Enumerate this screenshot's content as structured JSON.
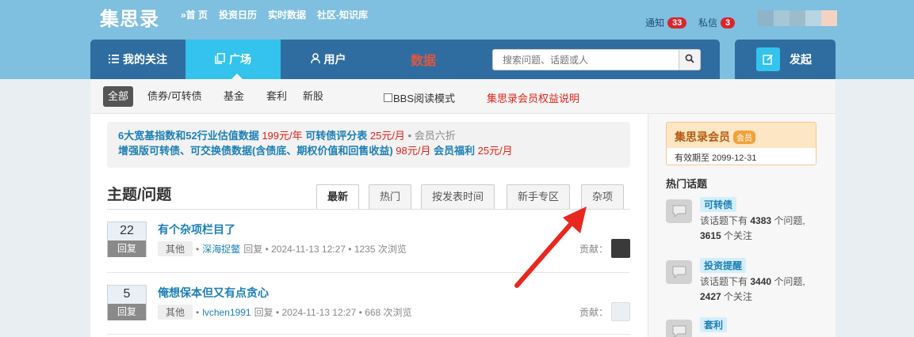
{
  "header": {
    "logo": "集思录",
    "nav": [
      "»首 页",
      "投资日历",
      "实时数据",
      "社区-知识库"
    ],
    "notifications_label": "通知",
    "notifications_count": "33",
    "messages_label": "私信",
    "messages_count": "3"
  },
  "main_nav": {
    "tabs": [
      {
        "label": "我的关注",
        "icon": "list-icon"
      },
      {
        "label": "广场",
        "icon": "copy-icon",
        "active": true
      },
      {
        "label": "用户",
        "icon": "user-icon"
      },
      {
        "label": "数据"
      }
    ],
    "search_placeholder": "搜索问题、话题或人",
    "post_label": "发起"
  },
  "filters": {
    "items": [
      "全部",
      "债券/可转债",
      "基金",
      "套利",
      "新股"
    ],
    "active": "全部",
    "bbs_mode": "BBS阅读模式",
    "member_rights": "集思录会员权益说明"
  },
  "promo": {
    "line1": [
      {
        "text": "6大宽基指数和52行业估值数据",
        "style": "blue"
      },
      {
        "text": " 199元/年",
        "style": "red"
      },
      {
        "text": "   可转债评分表",
        "style": "blue"
      },
      {
        "text": " 25元/月",
        "style": "red"
      },
      {
        "text": " • 会员六折",
        "style": "gray"
      }
    ],
    "line2": [
      {
        "text": "增强版可转债、可交换债数据(含债底、期权价值和回售收益)",
        "style": "blue"
      },
      {
        "text": " 98元/月",
        "style": "red"
      },
      {
        "text": "   会员福利",
        "style": "blue"
      },
      {
        "text": " 25元/月",
        "style": "red"
      }
    ]
  },
  "section": {
    "title": "主题/问题",
    "tabs": [
      "最新",
      "热门",
      "按发表时间",
      "新手专区",
      "杂项"
    ],
    "active_tab": "最新"
  },
  "questions": [
    {
      "count": "22",
      "count_label": "回复",
      "title": "有个杂项栏目了",
      "category": "其他",
      "user": "深海捉鳖",
      "meta": "回复 • 2024-11-13 12:27 • 1235 次浏览",
      "contrib_label": "贡献："
    },
    {
      "count": "5",
      "count_label": "回复",
      "title": "俺想保本但又有点贪心",
      "category": "其他",
      "user": "lvchen1991",
      "meta": "回复 • 2024-11-13 12:27 • 668 次浏览",
      "contrib_label": "贡献："
    }
  ],
  "sidebar": {
    "member_title": "集思录会员",
    "member_tag": "会员",
    "member_expiry": "有效期至 2099-12-31",
    "hot_topics_title": "热门话题",
    "topics": [
      {
        "name": "可转债",
        "line1_pre": "该话题下有 ",
        "questions": "4383",
        "line1_post": " 个问题,",
        "follows": "3615",
        "line2_post": " 个关注"
      },
      {
        "name": "投资提醒",
        "line1_pre": "该话题下有 ",
        "questions": "3440",
        "line1_post": " 个问题,",
        "follows": "2427",
        "line2_post": " 个关注"
      },
      {
        "name": "套利",
        "line1_pre": "该话题下有 ",
        "questions": "",
        "line1_post": "",
        "follows": "",
        "line2_post": ""
      }
    ]
  },
  "colors": {
    "header_bg": "#7fbfe0",
    "nav_bg": "#2f6da0",
    "nav_active": "#33c3ec",
    "link_blue": "#1c7fb5",
    "price_red": "#e2231a",
    "badge_red": "#d9262c"
  }
}
